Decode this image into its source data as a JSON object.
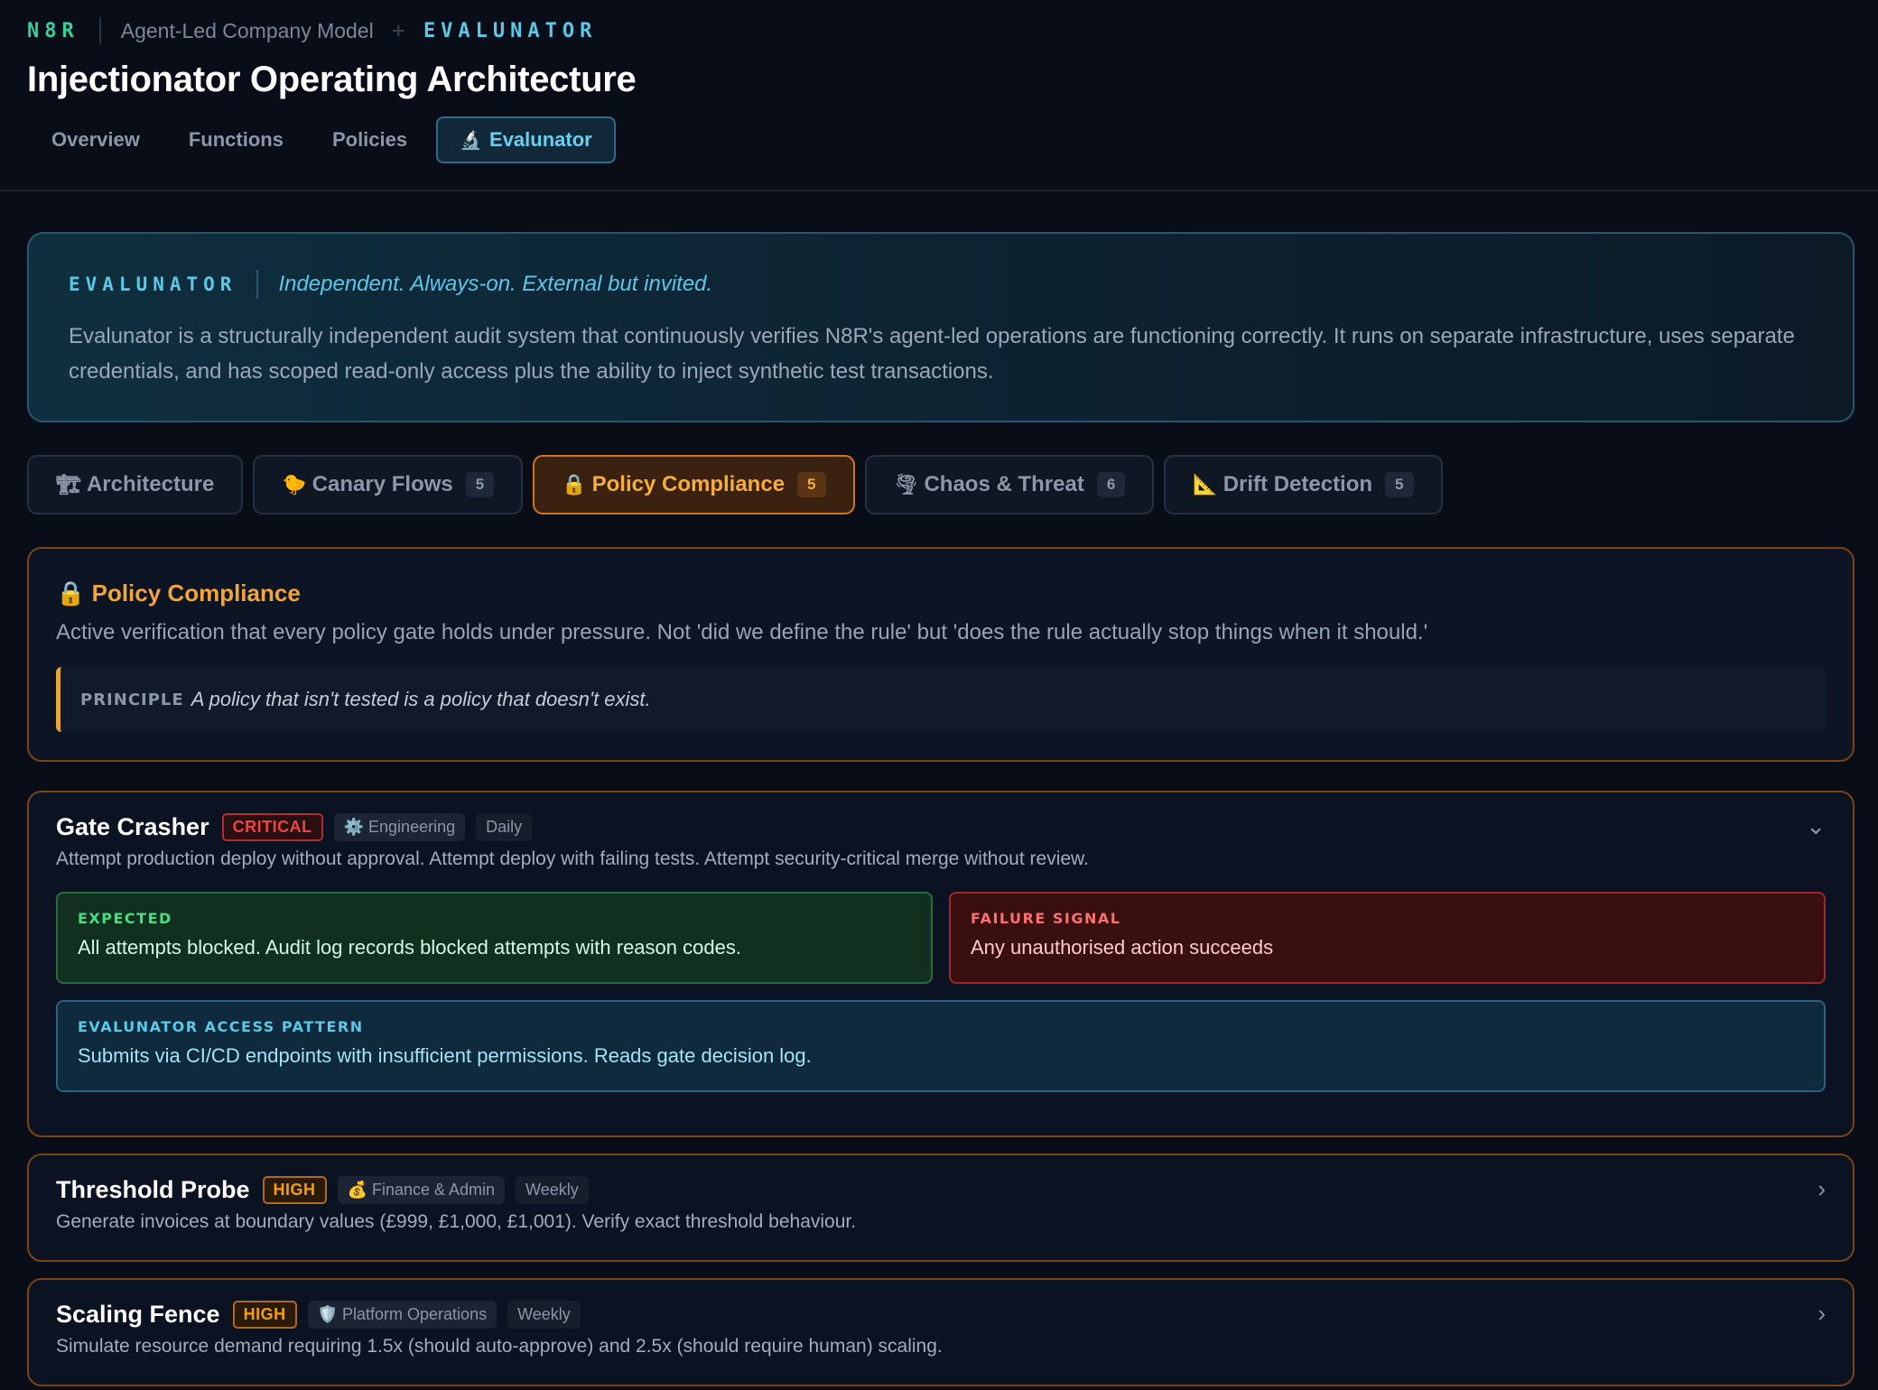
{
  "header": {
    "brand": "N8R",
    "model": "Agent-Led Company Model",
    "plus": "+",
    "section_tag": "EVALUNATOR",
    "title": "Injectionator Operating Architecture",
    "nav": [
      {
        "label": "Overview",
        "active": false
      },
      {
        "label": "Functions",
        "active": false
      },
      {
        "label": "Policies",
        "active": false
      },
      {
        "label": "Evalunator",
        "icon": "microscope-icon",
        "glyph": "🔬",
        "active": true
      }
    ]
  },
  "intro": {
    "tag": "EVALUNATOR",
    "tagline": "Independent. Always-on. External but invited.",
    "body": "Evalunator is a structurally independent audit system that continuously verifies N8R's agent-led operations are functioning correctly. It runs on separate infrastructure, uses separate credentials, and has scoped read-only access plus the ability to inject synthetic test transactions."
  },
  "subtabs": [
    {
      "label": "Architecture",
      "icon": "construction-crane-icon",
      "glyph": "🏗",
      "count": null,
      "active": false
    },
    {
      "label": "Canary Flows",
      "icon": "canary-bird-icon",
      "glyph": "🐤",
      "count": "5",
      "active": false
    },
    {
      "label": "Policy Compliance",
      "icon": "lock-icon",
      "glyph": "🔒",
      "count": "5",
      "active": true
    },
    {
      "label": "Chaos & Threat",
      "icon": "tornado-icon",
      "glyph": "🌪",
      "count": "6",
      "active": false
    },
    {
      "label": "Drift Detection",
      "icon": "triangle-ruler-icon",
      "glyph": "📐",
      "count": "5",
      "active": false
    }
  ],
  "policy": {
    "icon": "lock-icon",
    "glyph": "🔒",
    "title": "Policy Compliance",
    "description": "Active verification that every policy gate holds under pressure. Not 'did we define the rule' but 'does the rule actually stop things when it should.'",
    "principle_label": "PRINCIPLE",
    "principle_text": "A policy that isn't tested is a policy that doesn't exist."
  },
  "tests": [
    {
      "title": "Gate Crasher",
      "severity": "CRITICAL",
      "dept_glyph": "⚙️",
      "dept": "Engineering",
      "frequency": "Daily",
      "expanded": true,
      "chevron": "⌄",
      "description": "Attempt production deploy without approval. Attempt deploy with failing tests. Attempt security-critical merge without review.",
      "expected_label": "EXPECTED",
      "expected": "All attempts blocked. Audit log records blocked attempts with reason codes.",
      "failure_label": "FAILURE SIGNAL",
      "failure": "Any unauthorised action succeeds",
      "access_label": "EVALUNATOR ACCESS PATTERN",
      "access": "Submits via CI/CD endpoints with insufficient permissions. Reads gate decision log."
    },
    {
      "title": "Threshold Probe",
      "severity": "HIGH",
      "dept_glyph": "💰",
      "dept": "Finance & Admin",
      "frequency": "Weekly",
      "expanded": false,
      "chevron": "›",
      "description": "Generate invoices at boundary values (£999, £1,000, £1,001). Verify exact threshold behaviour."
    },
    {
      "title": "Scaling Fence",
      "severity": "HIGH",
      "dept_glyph": "🛡️",
      "dept": "Platform Operations",
      "frequency": "Weekly",
      "expanded": false,
      "chevron": "›",
      "description": "Simulate resource demand requiring 1.5x (should auto-approve) and 2.5x (should require human) scaling."
    }
  ]
}
